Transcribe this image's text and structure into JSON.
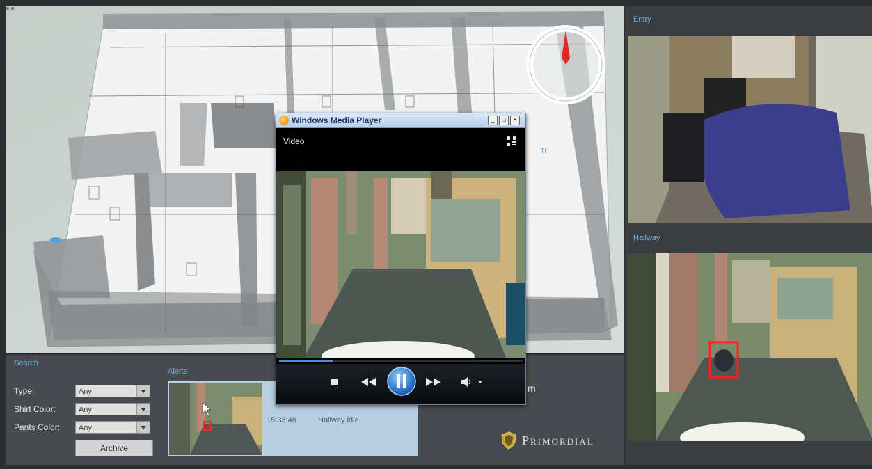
{
  "floorplan": {
    "compass_needle_color": "#d92a2a"
  },
  "search": {
    "title": "Search",
    "fields": [
      {
        "label": "Type:",
        "value": "Any"
      },
      {
        "label": "Shirt Color:",
        "value": "Any"
      },
      {
        "label": "Pants Color:",
        "value": "Any"
      }
    ],
    "archive_label": "Archive"
  },
  "alerts": {
    "title": "Alerts",
    "items": [
      {
        "time": "15:33:48",
        "description": "Hallway idle"
      }
    ]
  },
  "partial_text": "m",
  "logo_text": "Primordial",
  "cameras": {
    "entry": {
      "title": "Entry"
    },
    "hallway": {
      "title": "Hallway"
    }
  },
  "media_player": {
    "title": "Windows Media Player",
    "video_label": "Video",
    "buttons": {
      "minimize": "_",
      "maximize": "□",
      "close": "×"
    },
    "progress": 0.22,
    "accent": "#4a90d9"
  }
}
